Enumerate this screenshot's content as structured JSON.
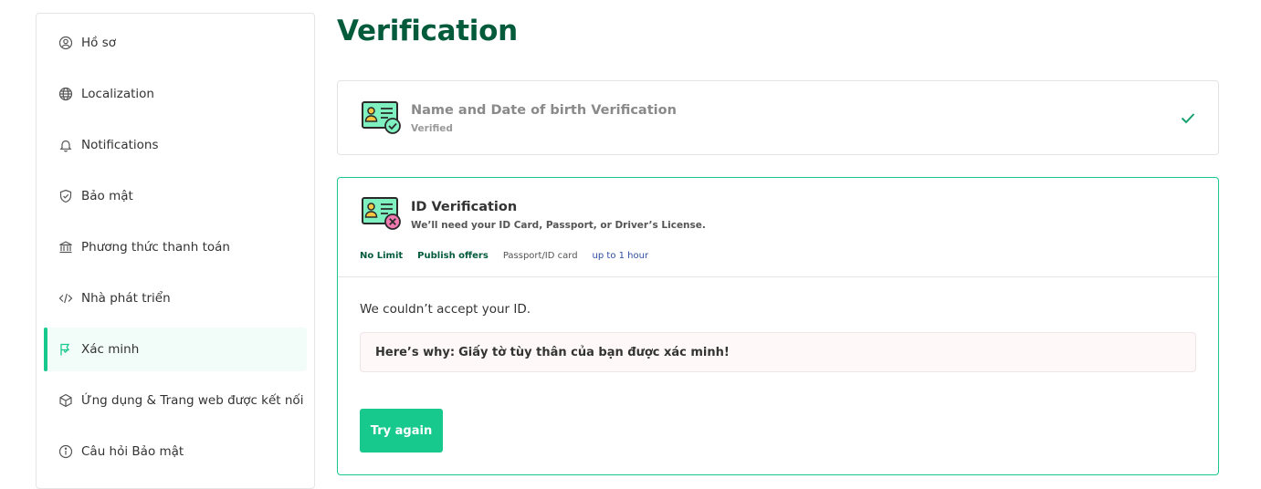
{
  "sidebar": {
    "items": [
      {
        "label": "Hồ sơ",
        "icon": "user-circle-icon"
      },
      {
        "label": "Localization",
        "icon": "globe-icon"
      },
      {
        "label": "Notifications",
        "icon": "bell-icon"
      },
      {
        "label": "Bảo mật",
        "icon": "shield-check-icon"
      },
      {
        "label": "Phương thức thanh toán",
        "icon": "bank-icon"
      },
      {
        "label": "Nhà phát triển",
        "icon": "code-icon"
      },
      {
        "label": "Xác minh",
        "icon": "flag-icon",
        "active": true
      },
      {
        "label": "Ứng dụng & Trang web được kết nối",
        "icon": "cube-icon"
      },
      {
        "label": "Câu hỏi Bảo mật",
        "icon": "info-circle-icon"
      }
    ]
  },
  "page": {
    "title": "Verification"
  },
  "name_card": {
    "title": "Name and Date of birth Verification",
    "status": "Verified",
    "icon": "id-card-verified-icon",
    "status_icon": "checkmark-icon"
  },
  "id_card": {
    "title": "ID Verification",
    "subtitle": "We’ll need your ID Card, Passport, or Driver’s License.",
    "icon": "id-card-rejected-icon",
    "tags": {
      "limit": "No Limit",
      "offers": "Publish offers",
      "document": "Passport/ID card",
      "time": "up to 1 hour"
    },
    "message": "We couldn’t accept your ID.",
    "why_label": "Here’s why:",
    "why_text": "Giấy tờ tùy thân của bạn được xác minh!",
    "button_label": "Try again"
  },
  "colors": {
    "accent": "#18c98d",
    "title": "#035b3c",
    "tag_blue": "#2c4fa3"
  }
}
